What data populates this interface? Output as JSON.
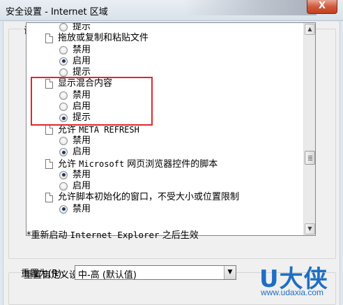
{
  "window": {
    "title": "安全设置 - Internet 区域",
    "close_label": "X"
  },
  "settings_group": {
    "legend": "设置"
  },
  "settings_list": [
    {
      "type": "option",
      "label": "提示",
      "checked": false
    },
    {
      "type": "setting",
      "label": "拖放或复制和粘贴文件"
    },
    {
      "type": "option",
      "label": "禁用",
      "checked": false
    },
    {
      "type": "option",
      "label": "启用",
      "checked": true
    },
    {
      "type": "option",
      "label": "提示",
      "checked": false
    },
    {
      "type": "setting",
      "label": "显示混合内容"
    },
    {
      "type": "option",
      "label": "禁用",
      "checked": false
    },
    {
      "type": "option",
      "label": "启用",
      "checked": false
    },
    {
      "type": "option",
      "label": "提示",
      "checked": true
    },
    {
      "type": "setting",
      "label": "允许 META REFRESH"
    },
    {
      "type": "option",
      "label": "禁用",
      "checked": false
    },
    {
      "type": "option",
      "label": "启用",
      "checked": true
    },
    {
      "type": "setting",
      "label": "允许 Microsoft 网页浏览器控件的脚本"
    },
    {
      "type": "option",
      "label": "禁用",
      "checked": true
    },
    {
      "type": "option",
      "label": "启用",
      "checked": false
    },
    {
      "type": "setting",
      "label": "允许脚本初始化的窗口，不受大小或位置限制"
    },
    {
      "type": "option",
      "label": "禁用",
      "checked": true
    }
  ],
  "note": "*重新启动 Internet Explorer 之后生效",
  "reset_group": {
    "legend": "重置自定义设置",
    "reset_to_label": "重置为(R):",
    "selected_value": "中-高 (默认值)"
  },
  "watermark": {
    "brand": "U大侠",
    "url": "www.udaxia.com"
  },
  "colors": {
    "highlight_border": "#e2262b",
    "watermark": "#1e6fc4"
  }
}
